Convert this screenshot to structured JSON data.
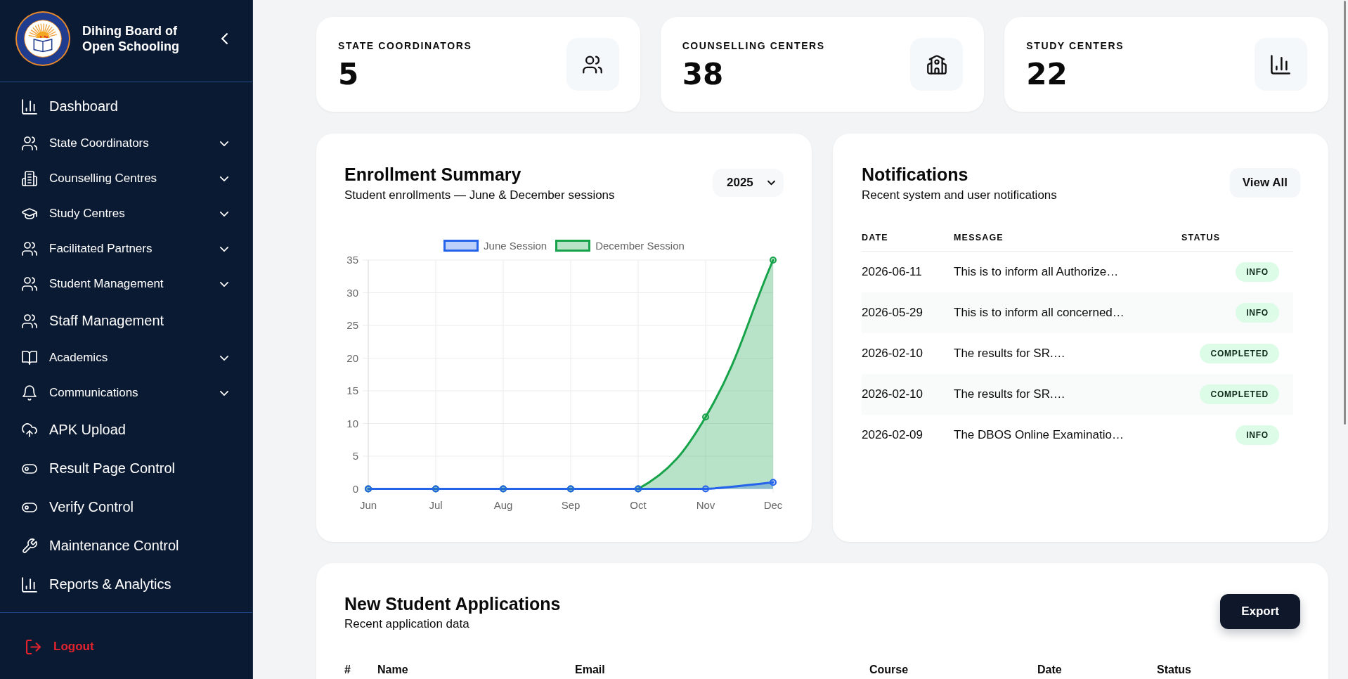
{
  "sidebar": {
    "title": "Dihing Board of Open Schooling",
    "items": [
      {
        "label": "Dashboard",
        "expandable": false
      },
      {
        "label": "State Coordinators",
        "expandable": true
      },
      {
        "label": "Counselling Centres",
        "expandable": true
      },
      {
        "label": "Study Centres",
        "expandable": true
      },
      {
        "label": "Facilitated Partners",
        "expandable": true
      },
      {
        "label": "Student Management",
        "expandable": true
      },
      {
        "label": "Staff Management",
        "expandable": false
      },
      {
        "label": "Academics",
        "expandable": true
      },
      {
        "label": "Communications",
        "expandable": true
      },
      {
        "label": "APK Upload",
        "expandable": false
      },
      {
        "label": "Result Page Control",
        "expandable": false
      },
      {
        "label": "Verify Control",
        "expandable": false
      },
      {
        "label": "Maintenance Control",
        "expandable": false
      },
      {
        "label": "Reports & Analytics",
        "expandable": false
      }
    ],
    "logout": "Logout"
  },
  "stats": [
    {
      "label": "STATE COORDINATORS",
      "value": "5"
    },
    {
      "label": "COUNSELLING CENTERS",
      "value": "38"
    },
    {
      "label": "STUDY CENTERS",
      "value": "22"
    }
  ],
  "enrollment": {
    "title": "Enrollment Summary",
    "subtitle": "Student enrollments — June & December sessions",
    "year": "2025",
    "chart_data": {
      "type": "area",
      "categories": [
        "Jun",
        "Jul",
        "Aug",
        "Sep",
        "Oct",
        "Nov",
        "Dec"
      ],
      "series": [
        {
          "name": "June Session",
          "color": "#2563eb",
          "values": [
            0,
            0,
            0,
            0,
            0,
            0,
            1
          ]
        },
        {
          "name": "December Session",
          "color": "#16a34a",
          "values": [
            0,
            0,
            0,
            0,
            0,
            11,
            35
          ]
        }
      ],
      "ylim": [
        0,
        35
      ],
      "yticks": [
        0,
        {
          "value": 5,
          "label": "5"
        },
        10,
        15,
        20,
        25,
        30,
        35
      ],
      "grid": true,
      "legend": true
    }
  },
  "notifications": {
    "title": "Notifications",
    "subtitle": "Recent system and user notifications",
    "button": "View All",
    "columns": [
      "DATE",
      "MESSAGE",
      "STATUS"
    ],
    "rows": [
      {
        "date": "2026-06-11",
        "message": "This is to inform all Authorize…",
        "status": "INFO"
      },
      {
        "date": "2026-05-29",
        "message": "This is to inform all concerned…",
        "status": "INFO"
      },
      {
        "date": "2026-02-10",
        "message": "The results for SR.…",
        "status": "COMPLETED"
      },
      {
        "date": "2026-02-10",
        "message": "The results for SR.…",
        "status": "COMPLETED"
      },
      {
        "date": "2026-02-09",
        "message": "The DBOS Online Examinatio…",
        "status": "INFO"
      }
    ]
  },
  "applications": {
    "title": "New Student Applications",
    "subtitle": "Recent application data",
    "button": "Export",
    "columns": [
      "#",
      "Name",
      "Email",
      "Course",
      "Date",
      "Status"
    ]
  }
}
